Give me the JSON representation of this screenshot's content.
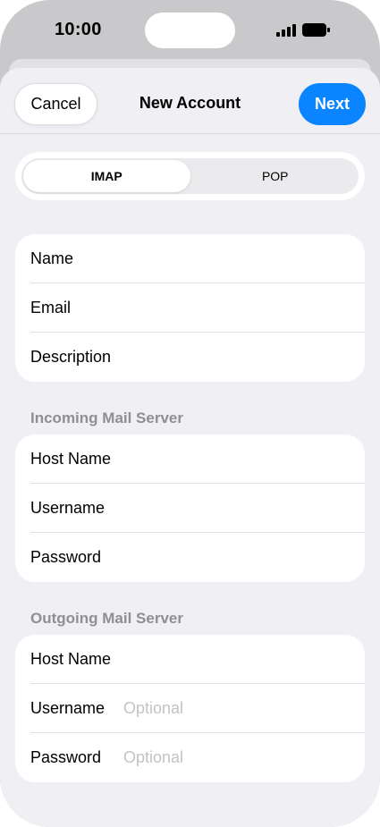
{
  "status_bar": {
    "time": "10:00"
  },
  "nav": {
    "cancel_label": "Cancel",
    "title": "New Account",
    "next_label": "Next"
  },
  "segmented": {
    "options": [
      "IMAP",
      "POP"
    ],
    "selected": "IMAP"
  },
  "account_group": {
    "rows": [
      {
        "label": "Name"
      },
      {
        "label": "Email"
      },
      {
        "label": "Description"
      }
    ]
  },
  "incoming": {
    "header": "Incoming Mail Server",
    "rows": [
      {
        "label": "Host Name"
      },
      {
        "label": "Username"
      },
      {
        "label": "Password"
      }
    ]
  },
  "outgoing": {
    "header": "Outgoing Mail Server",
    "rows": [
      {
        "label": "Host Name"
      },
      {
        "label": "Username",
        "placeholder": "Optional"
      },
      {
        "label": "Password",
        "placeholder": "Optional"
      }
    ]
  },
  "colors": {
    "accent": "#0a84ff",
    "background": "#efeff4",
    "secondary_text": "#8e8e93"
  }
}
